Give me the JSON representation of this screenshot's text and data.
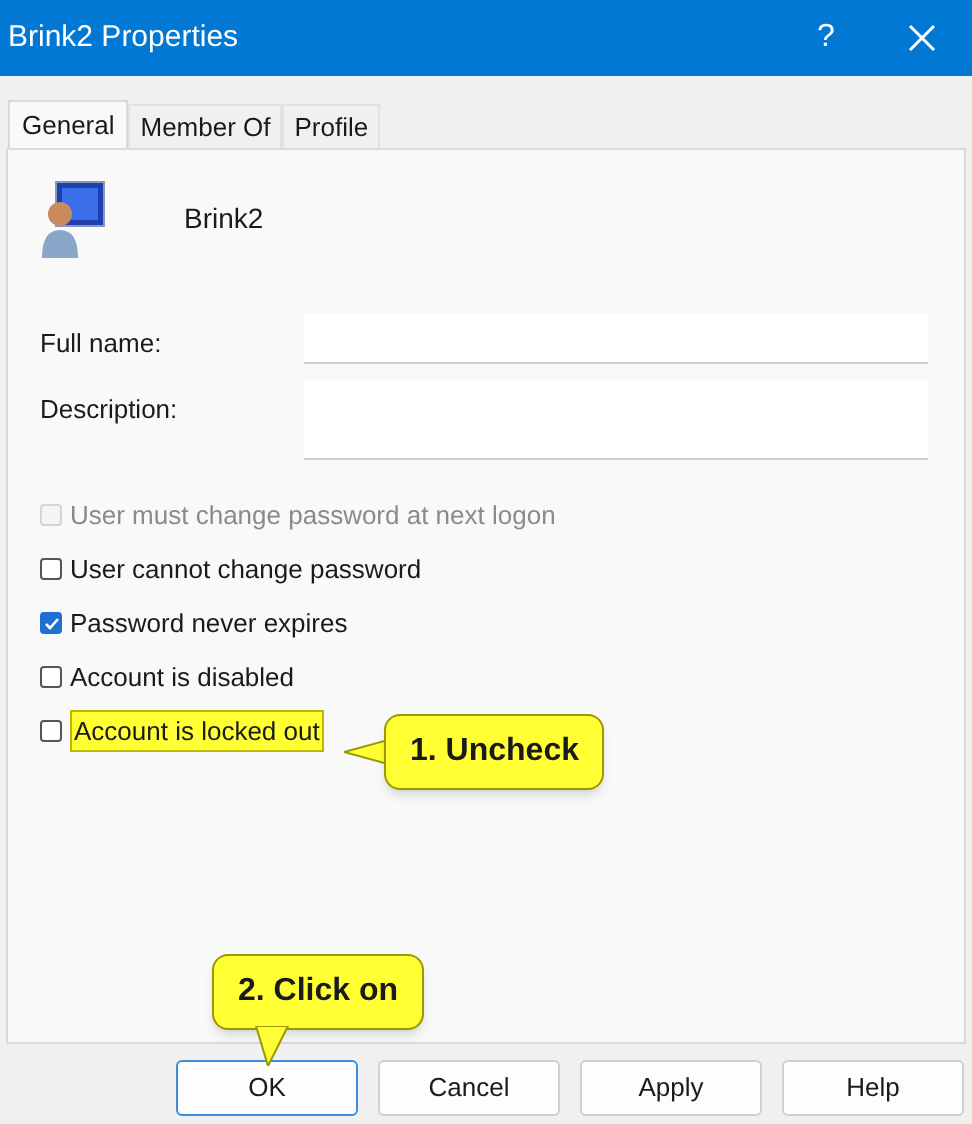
{
  "window": {
    "title": "Brink2 Properties",
    "help": "?"
  },
  "tabs": [
    {
      "label": "General",
      "selected": true
    },
    {
      "label": "Member Of",
      "selected": false
    },
    {
      "label": "Profile",
      "selected": false
    }
  ],
  "user": {
    "name": "Brink2"
  },
  "fields": [
    {
      "label": "Full name:",
      "kind": "line"
    },
    {
      "label": "Description:",
      "kind": "box"
    }
  ],
  "options": [
    {
      "label": "User must change password at next logon",
      "checked": false,
      "disabled": true,
      "highlighted": false
    },
    {
      "label": "User cannot change password",
      "checked": false,
      "disabled": false,
      "highlighted": false
    },
    {
      "label": "Password never expires",
      "checked": true,
      "disabled": false,
      "highlighted": false
    },
    {
      "label": "Account is disabled",
      "checked": false,
      "disabled": false,
      "highlighted": false
    },
    {
      "label": "Account is locked out",
      "checked": false,
      "disabled": false,
      "highlighted": true
    }
  ],
  "callouts": [
    {
      "text": "1. Uncheck",
      "kind": "left"
    },
    {
      "text": "2. Click on",
      "kind": "down"
    }
  ],
  "buttons": [
    {
      "label": "OK",
      "default": true
    },
    {
      "label": "Cancel",
      "default": false
    },
    {
      "label": "Apply",
      "default": false
    },
    {
      "label": "Help",
      "default": false
    }
  ]
}
